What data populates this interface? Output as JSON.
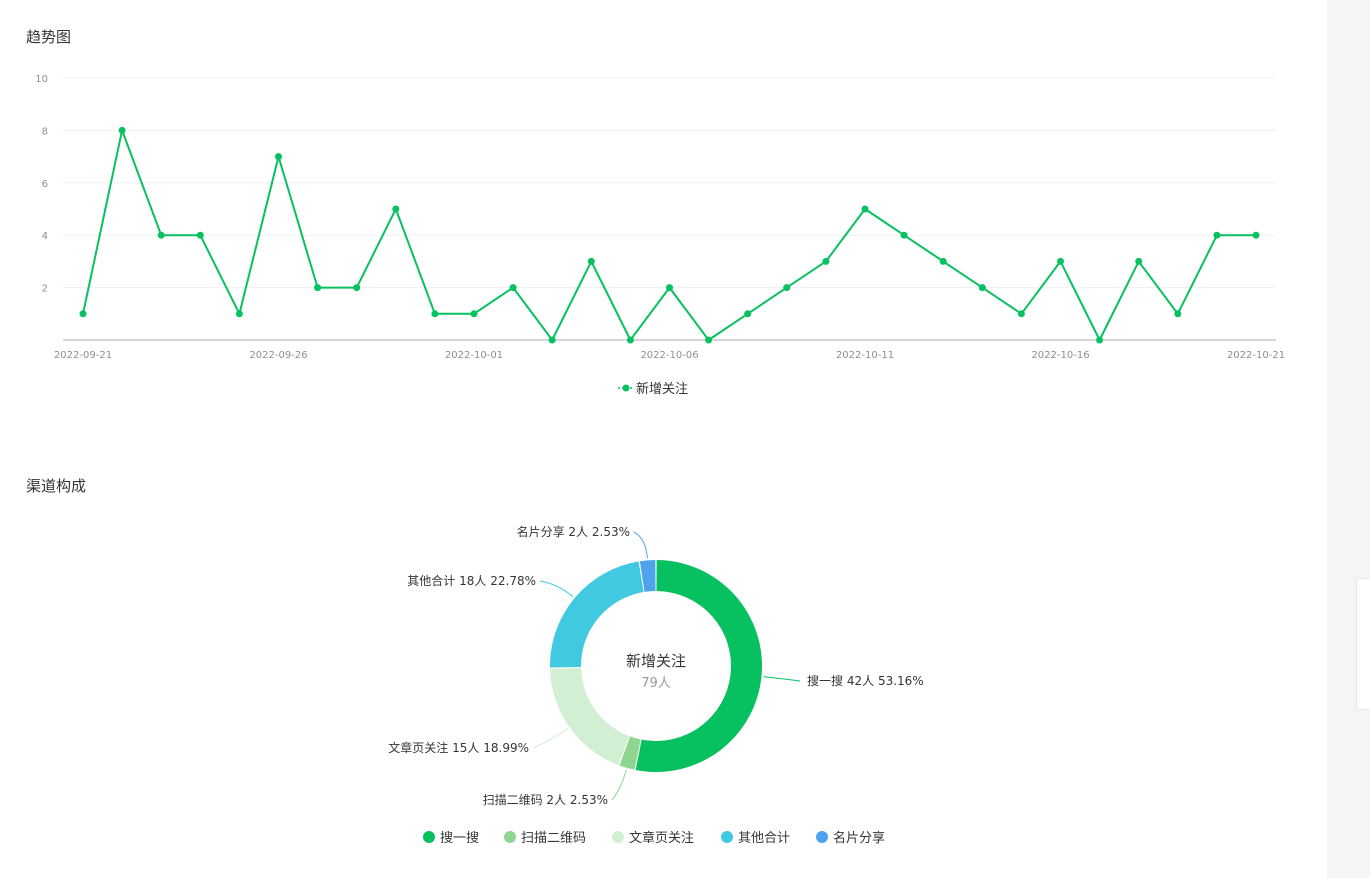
{
  "trend": {
    "title": "趋势图"
  },
  "channel": {
    "title": "渠道构成"
  },
  "chart_data": [
    {
      "type": "line",
      "series": [
        {
          "name": "新增关注",
          "color": "#07c160",
          "x": [
            "2022-09-21",
            "2022-09-22",
            "2022-09-23",
            "2022-09-24",
            "2022-09-25",
            "2022-09-26",
            "2022-09-27",
            "2022-09-28",
            "2022-09-29",
            "2022-09-30",
            "2022-10-01",
            "2022-10-02",
            "2022-10-03",
            "2022-10-04",
            "2022-10-05",
            "2022-10-06",
            "2022-10-07",
            "2022-10-08",
            "2022-10-09",
            "2022-10-10",
            "2022-10-11",
            "2022-10-12",
            "2022-10-13",
            "2022-10-14",
            "2022-10-15",
            "2022-10-16",
            "2022-10-17",
            "2022-10-18",
            "2022-10-19",
            "2022-10-20",
            "2022-10-21"
          ],
          "values": [
            1,
            8,
            4,
            4,
            1,
            7,
            2,
            2,
            5,
            1,
            1,
            2,
            0,
            3,
            0,
            2,
            0,
            1,
            2,
            3,
            5,
            4,
            3,
            2,
            1,
            3,
            0,
            3,
            1,
            4,
            4
          ]
        }
      ],
      "x_tick_labels": [
        "2022-09-21",
        "2022-09-26",
        "2022-10-01",
        "2022-10-06",
        "2022-10-11",
        "2022-10-16",
        "2022-10-21"
      ],
      "y_tick_labels": [
        "2",
        "4",
        "6",
        "8",
        "10"
      ],
      "ylim": [
        0,
        10
      ],
      "grid": true,
      "legend_position": "bottom-center"
    },
    {
      "type": "pie",
      "style": "donut",
      "center_title": "新增关注",
      "center_value": "79人",
      "slices": [
        {
          "name": "搜一搜",
          "value": 42,
          "count_text": "42人",
          "percent_text": "53.16%",
          "color": "#07c160"
        },
        {
          "name": "扫描二维码",
          "value": 2,
          "count_text": "2人",
          "percent_text": "2.53%",
          "color": "#8ed590"
        },
        {
          "name": "文章页关注",
          "value": 15,
          "count_text": "15人",
          "percent_text": "18.99%",
          "color": "#d2efd3"
        },
        {
          "name": "其他合计",
          "value": 18,
          "count_text": "18人",
          "percent_text": "22.78%",
          "color": "#40c9e0"
        },
        {
          "name": "名片分享",
          "value": 2,
          "count_text": "2人",
          "percent_text": "2.53%",
          "color": "#4fa3ec"
        }
      ],
      "legend_position": "bottom-center"
    }
  ]
}
